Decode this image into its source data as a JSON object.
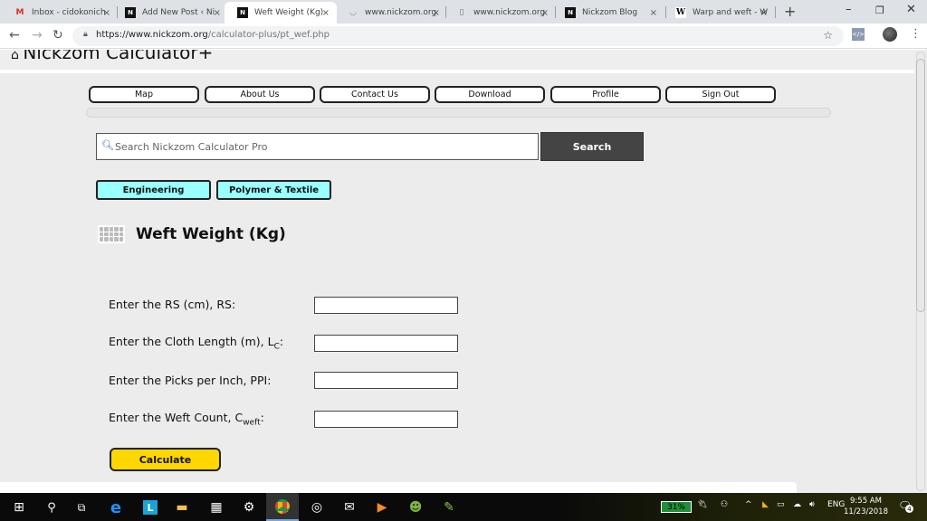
{
  "browser": {
    "tabs": [
      {
        "title": "Inbox - cidokonich",
        "favicon": "gmail-icon",
        "active": false
      },
      {
        "title": "Add New Post ‹ Ni",
        "favicon": "nickzom-icon",
        "active": false
      },
      {
        "title": "Weft Weight (Kg)",
        "favicon": "nickzom-icon",
        "active": true
      },
      {
        "title": "www.nickzom.org",
        "favicon": "loading-icon",
        "active": false
      },
      {
        "title": "www.nickzom.org",
        "favicon": "page-icon",
        "active": false
      },
      {
        "title": "Nickzom Blog",
        "favicon": "nickzom-icon",
        "active": false
      },
      {
        "title": "Warp and weft - W",
        "favicon": "wikipedia-icon",
        "active": false
      }
    ],
    "close_glyph": "×",
    "new_tab_glyph": "+",
    "url_host": "https://www.nickzom.org",
    "url_path": "/calculator-plus/pt_wef.php"
  },
  "site": {
    "title": "Nickzom Calculator+",
    "menu": [
      "Map",
      "About Us",
      "Contact Us",
      "Download",
      "Profile",
      "Sign Out"
    ],
    "search": {
      "placeholder": "Search Nickzom Calculator Pro",
      "value": "",
      "button": "Search"
    },
    "categories": [
      "Engineering",
      "Polymer & Textile"
    ]
  },
  "calculator": {
    "title": "Weft Weight (Kg)",
    "fields": [
      {
        "label": "Enter the RS (cm), RS:",
        "sub": "",
        "suffix": "",
        "value": ""
      },
      {
        "label": "Enter the Cloth Length (m), L",
        "sub": "C",
        "suffix": ":",
        "value": ""
      },
      {
        "label": "Enter the Picks per Inch, PPI:",
        "sub": "",
        "suffix": "",
        "value": ""
      },
      {
        "label": "Enter the Weft Count, C",
        "sub": "weft",
        "suffix": ":",
        "value": ""
      }
    ],
    "button": "Calculate"
  },
  "taskbar": {
    "battery": "31%",
    "language": "ENG",
    "time": "9:55 AM",
    "date": "11/23/2018",
    "notifications": "4"
  }
}
